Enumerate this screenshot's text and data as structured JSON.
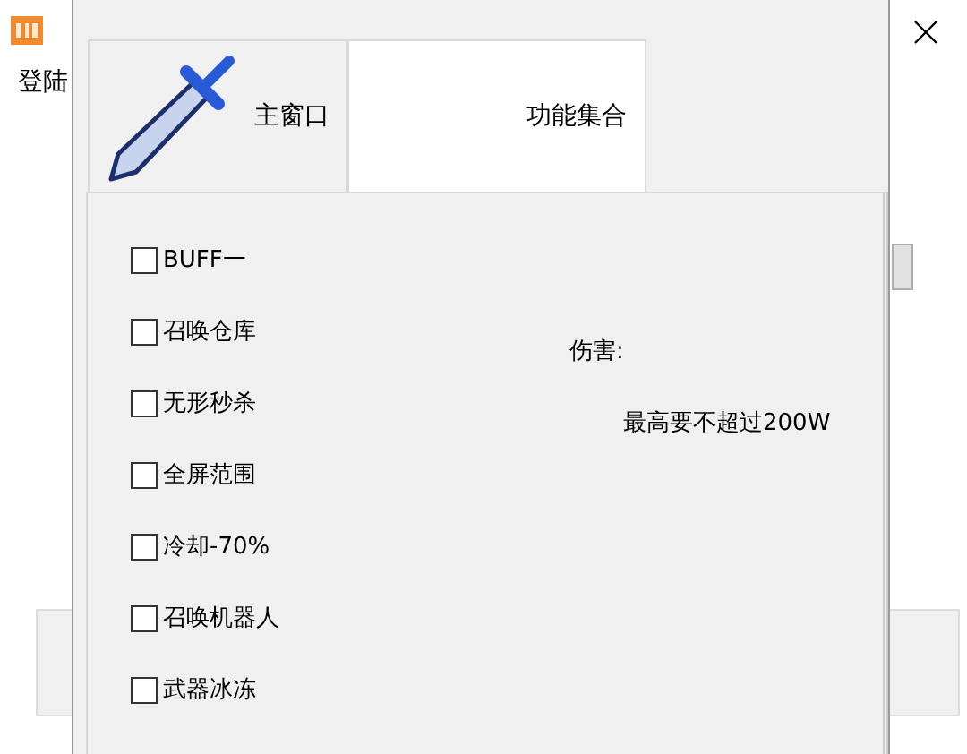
{
  "back_window": {
    "menu": [
      "登陆"
    ]
  },
  "front_window": {
    "tabs": [
      {
        "label": "主窗口",
        "selected": false
      },
      {
        "label": "功能集合",
        "selected": true
      }
    ],
    "options": [
      {
        "label": "BUFF一",
        "checked": false
      },
      {
        "label": "召唤仓库",
        "checked": false
      },
      {
        "label": "无形秒杀",
        "checked": false
      },
      {
        "label": "全屏范围",
        "checked": false
      },
      {
        "label": "冷却-70%",
        "checked": false
      },
      {
        "label": "召唤机器人",
        "checked": false
      },
      {
        "label": "武器冰冻",
        "checked": false
      }
    ],
    "damage_label": "伤害:",
    "damage_note": "最高要不超过200W"
  }
}
